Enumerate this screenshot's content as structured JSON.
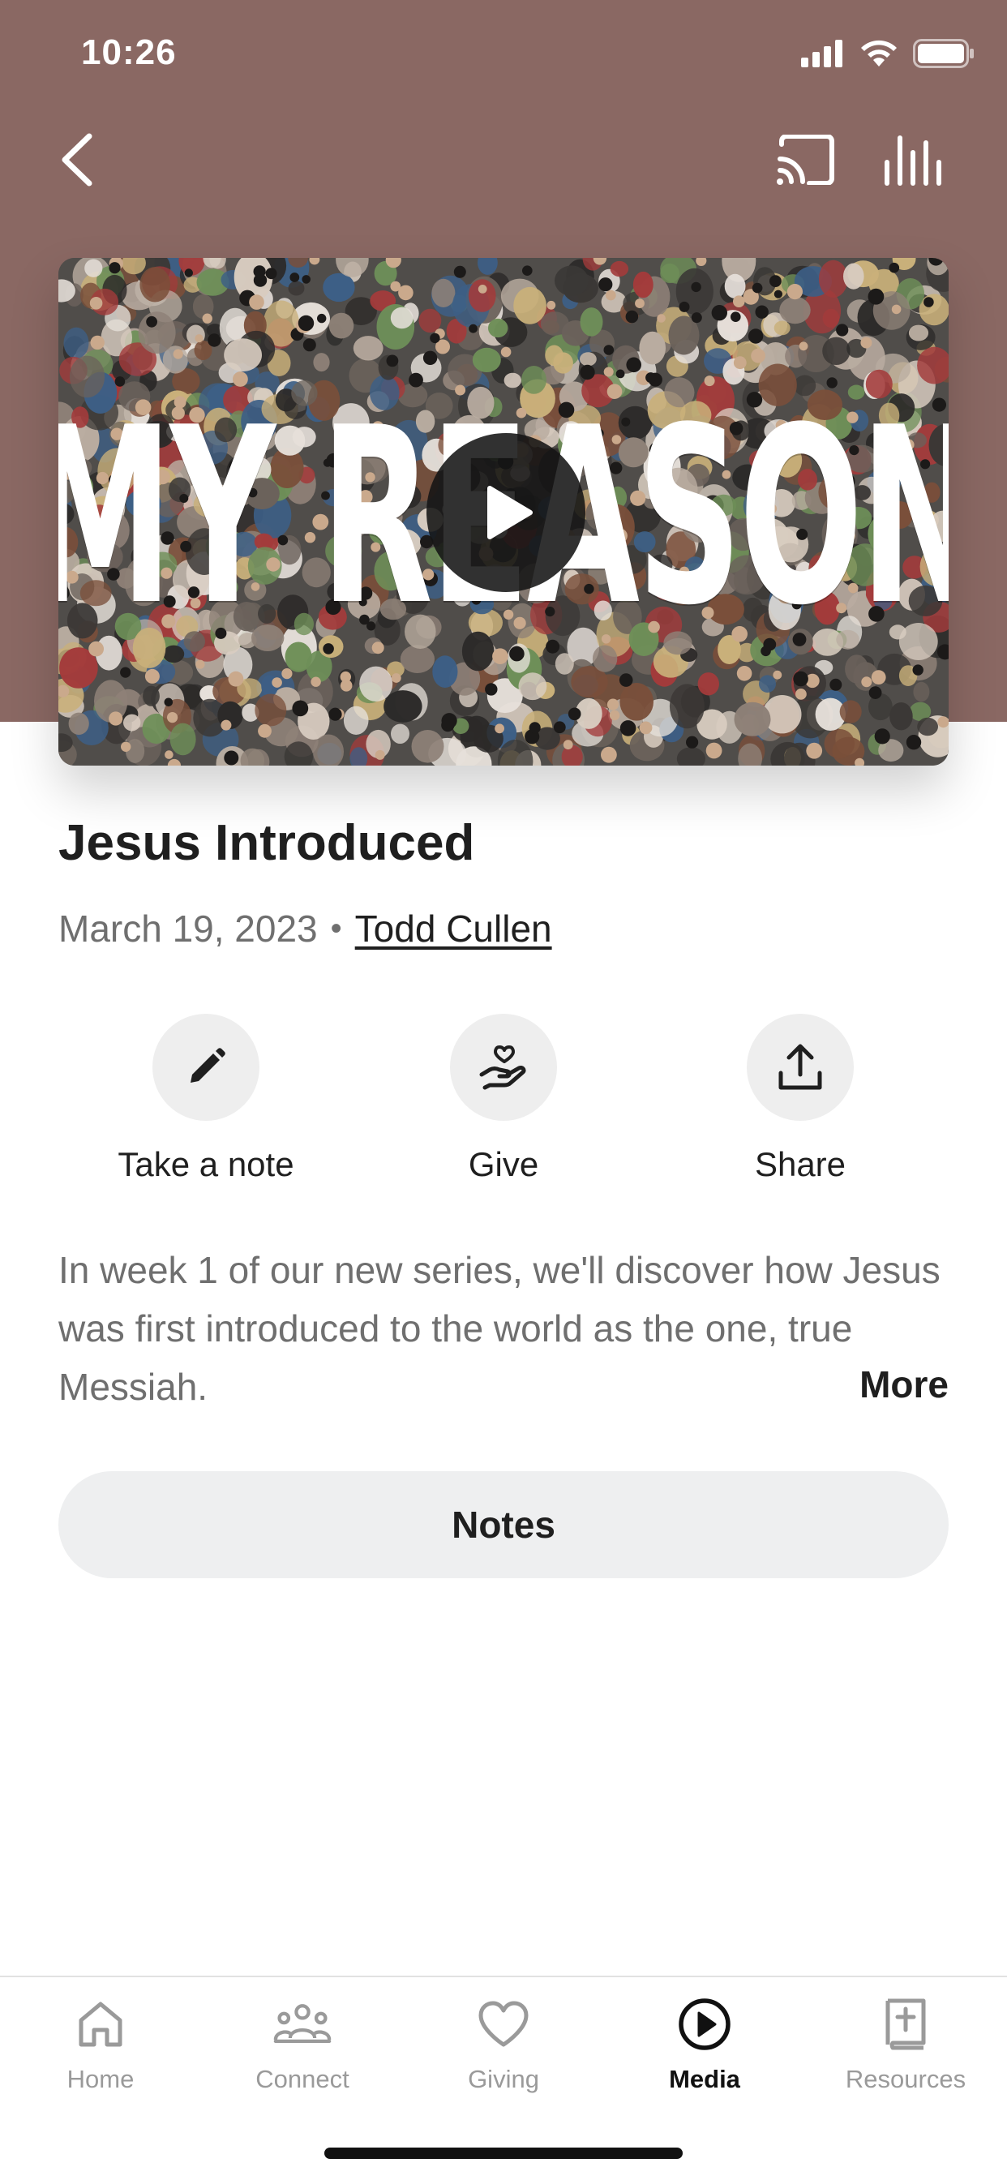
{
  "status_bar": {
    "time": "10:26"
  },
  "header": {
    "back_icon": "chevron-left-icon",
    "cast_icon": "cast-icon",
    "audio_icon": "equalizer-icon",
    "background_color": "#8a6863"
  },
  "video": {
    "artwork_title": "MY REASON",
    "play_icon": "play-icon"
  },
  "sermon": {
    "title": "Jesus Introduced",
    "date": "March 19, 2023",
    "separator": "•",
    "speaker": "Todd Cullen"
  },
  "actions": [
    {
      "label": "Take a note",
      "icon": "pencil-icon"
    },
    {
      "label": "Give",
      "icon": "heart-hand-icon"
    },
    {
      "label": "Share",
      "icon": "share-icon"
    }
  ],
  "description": {
    "text": "In week 1 of our new series, we'll discover how Jesus was first introduced to the world as the one, true Messiah.",
    "more_label": "More"
  },
  "notes_button": {
    "label": "Notes"
  },
  "tab_bar": {
    "active": "Media",
    "tabs": [
      {
        "label": "Home",
        "icon": "home-icon"
      },
      {
        "label": "Connect",
        "icon": "people-icon"
      },
      {
        "label": "Giving",
        "icon": "heart-icon"
      },
      {
        "label": "Media",
        "icon": "play-circle-icon"
      },
      {
        "label": "Resources",
        "icon": "bible-icon"
      }
    ]
  }
}
